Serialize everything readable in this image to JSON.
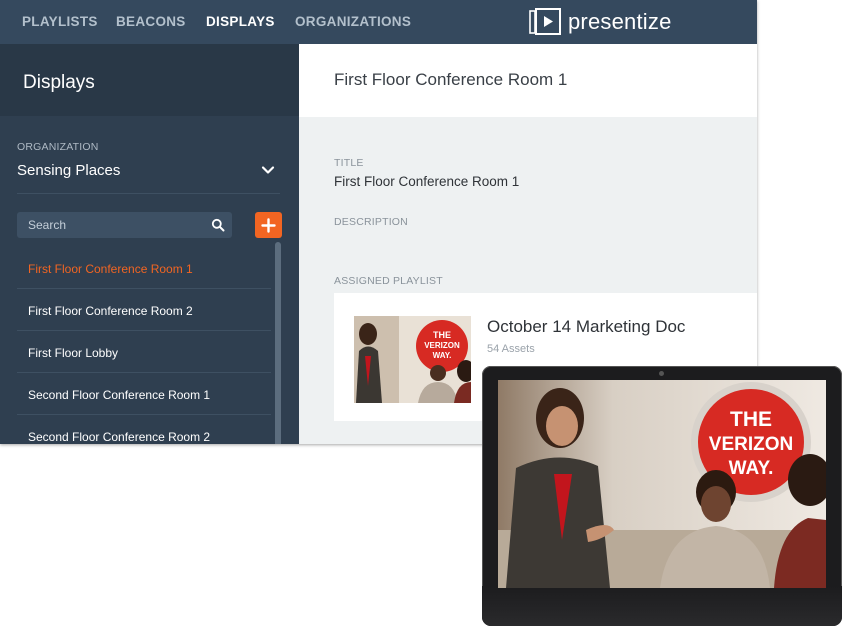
{
  "nav": {
    "items": [
      {
        "label": "PLAYLISTS"
      },
      {
        "label": "BEACONS"
      },
      {
        "label": "DISPLAYS"
      },
      {
        "label": "ORGANIZATIONS"
      }
    ],
    "brand": "presentize"
  },
  "sidebar": {
    "title": "Displays",
    "org_label": "ORGANIZATION",
    "org_value": "Sensing Places",
    "search_placeholder": "Search",
    "items": [
      {
        "label": "First Floor Conference Room 1"
      },
      {
        "label": "First Floor Conference Room 2"
      },
      {
        "label": "First Floor Lobby"
      },
      {
        "label": "Second Floor Conference Room 1"
      },
      {
        "label": "Second Floor Conference Room 2"
      }
    ]
  },
  "main": {
    "header_title": "First Floor Conference Room 1",
    "title_label": "TITLE",
    "title_value": "First Floor Conference Room 1",
    "description_label": "DESCRIPTION",
    "assigned_label": "ASSIGNED PLAYLIST",
    "playlist": {
      "name": "October 14 Marketing Doc",
      "assets": "54 Assets"
    }
  },
  "image": {
    "sign_lines": [
      "THE",
      "VERIZON",
      "WAY."
    ]
  },
  "colors": {
    "nav_bg": "#35495e",
    "sidebar_bg": "#2f3f50",
    "accent": "#f26522",
    "selected_text": "#f26522"
  },
  "icons": {
    "brand": "play-window-icon",
    "chevron": "chevron-down-icon",
    "search": "search-icon",
    "add": "plus-icon"
  }
}
